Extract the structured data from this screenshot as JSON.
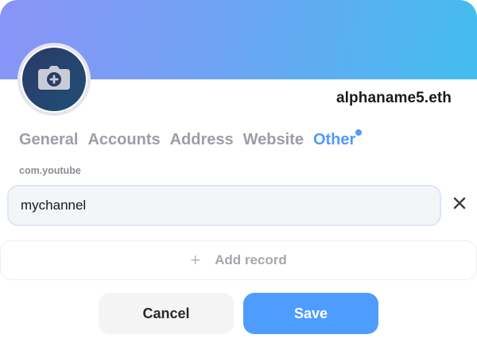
{
  "profile": {
    "name": "alphaname5.eth",
    "avatar_icon": "camera-plus-icon"
  },
  "tabs": [
    {
      "label": "General",
      "active": false
    },
    {
      "label": "Accounts",
      "active": false
    },
    {
      "label": "Address",
      "active": false
    },
    {
      "label": "Website",
      "active": false
    },
    {
      "label": "Other",
      "active": true,
      "has_indicator": true
    }
  ],
  "record": {
    "key_label": "com.youtube",
    "value": "mychannel",
    "clear_icon": "close-icon"
  },
  "add_record": {
    "icon": "plus-icon",
    "label": "Add record"
  },
  "actions": {
    "cancel_label": "Cancel",
    "save_label": "Save"
  },
  "colors": {
    "accent": "#5298ff",
    "save_button": "#4f9cff",
    "banner_start": "#8a93f7",
    "banner_end": "#43bdee",
    "avatar": "#2b3a67"
  }
}
